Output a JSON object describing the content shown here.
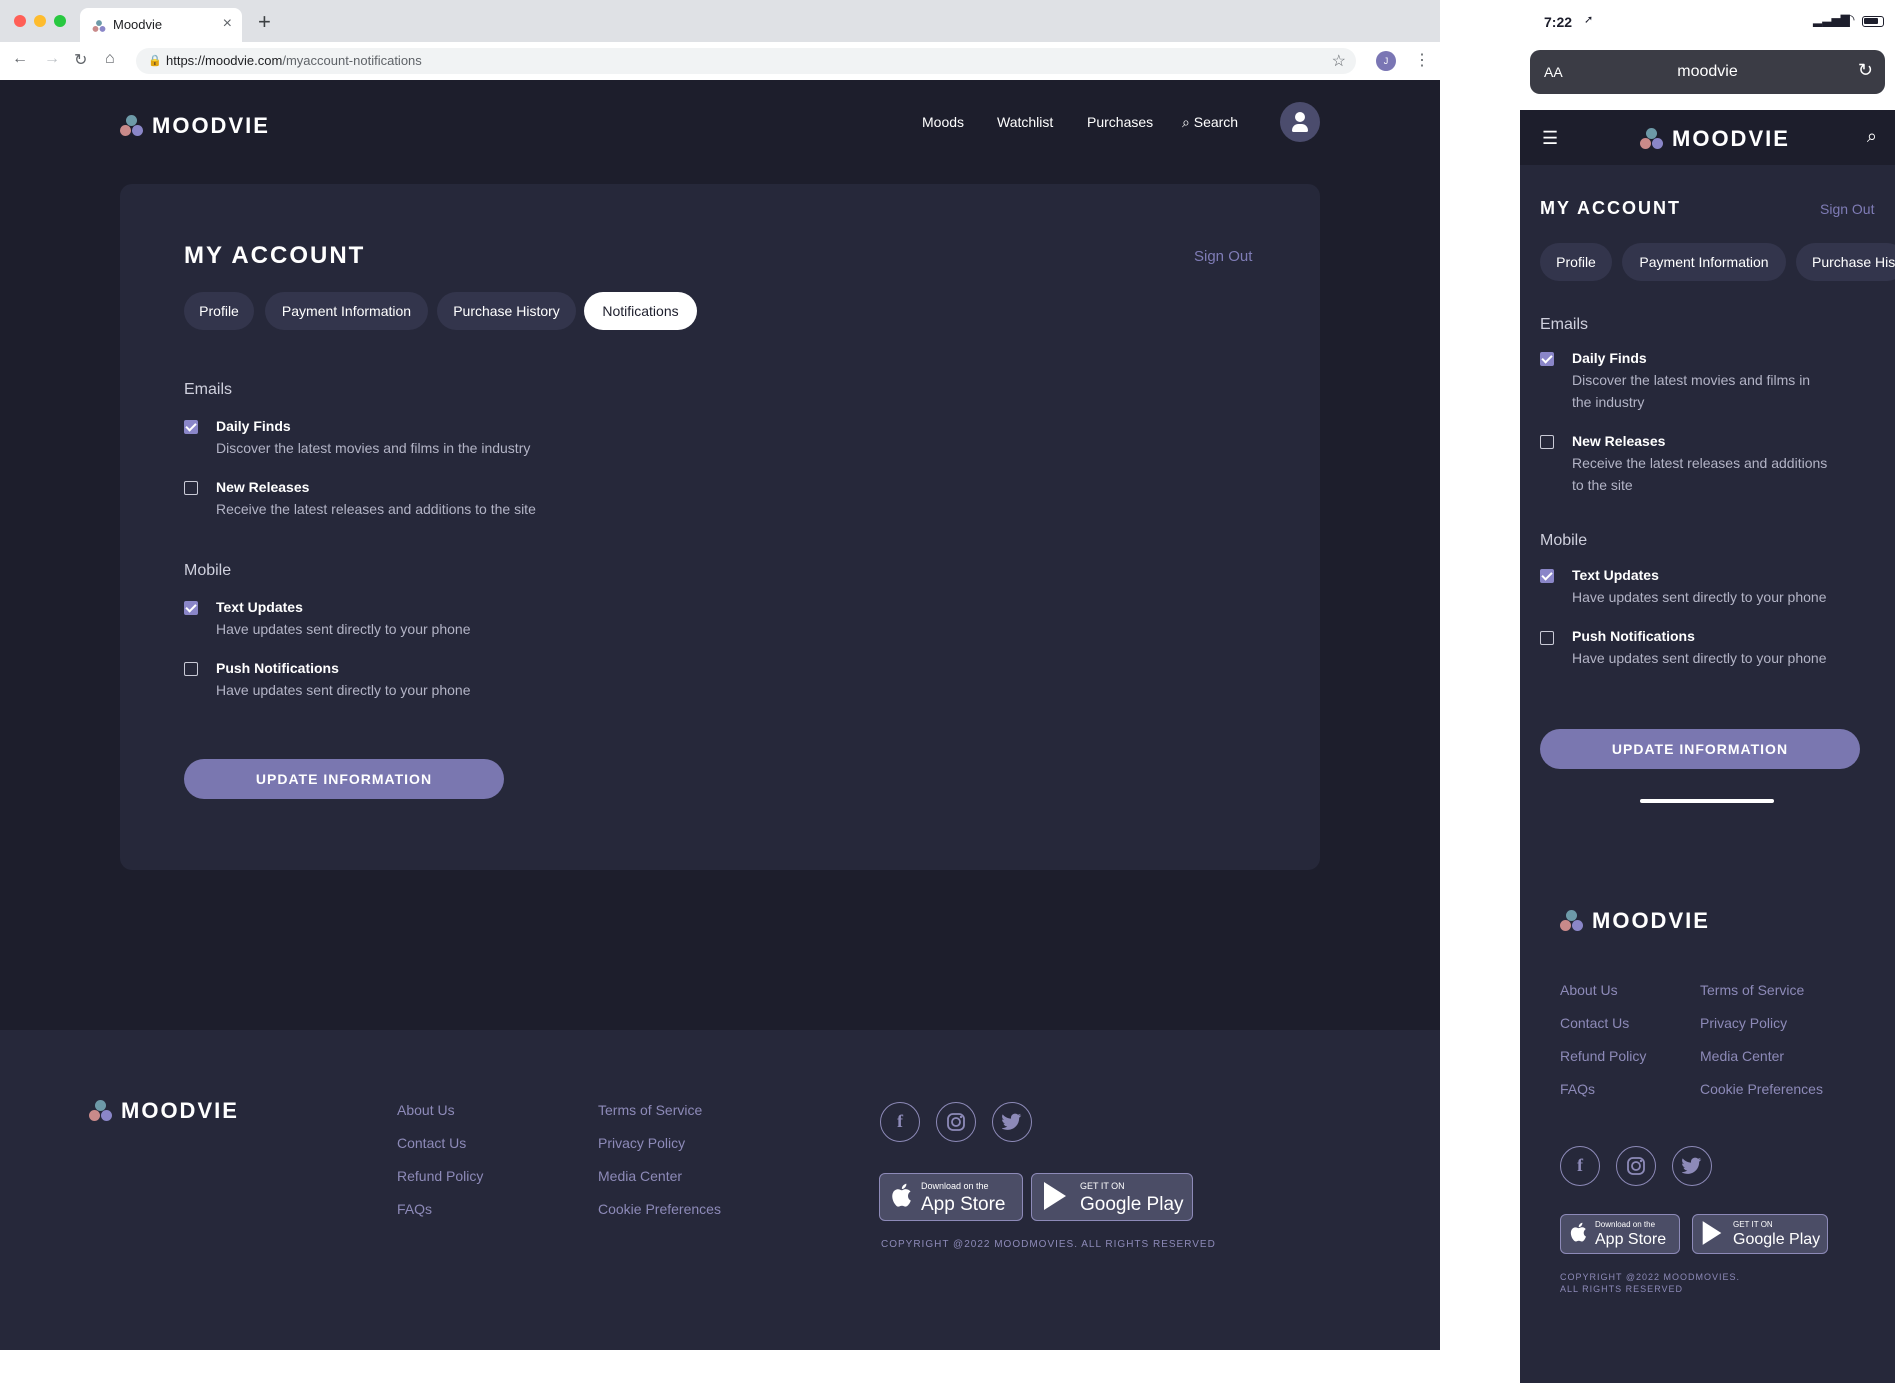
{
  "browser": {
    "tab_title": "Moodvie",
    "url_host": "https://moodvie.com",
    "url_path": "/myaccount-notifications",
    "profile_initial": "J"
  },
  "brand": {
    "name": "MOODVIE"
  },
  "nav": {
    "moods": "Moods",
    "watchlist": "Watchlist",
    "purchases": "Purchases",
    "search": "Search"
  },
  "account": {
    "title": "MY ACCOUNT",
    "sign_out": "Sign Out",
    "tabs": [
      "Profile",
      "Payment Information",
      "Purchase History",
      "Notifications"
    ],
    "tabs_mobile": [
      "Profile",
      "Payment Information",
      "Purchase Hist"
    ],
    "active_tab": "Notifications",
    "emails_heading": "Emails",
    "mobile_heading": "Mobile",
    "options": [
      {
        "label": "Daily Finds",
        "desc": "Discover the latest movies and films in the industry",
        "desc_m1": "Discover the latest movies and films in",
        "desc_m2": "the industry",
        "checked": true
      },
      {
        "label": "New Releases",
        "desc": "Receive the latest releases and additions to the site",
        "desc_m1": "Receive the latest releases and additions",
        "desc_m2": "to the site",
        "checked": false
      },
      {
        "label": "Text Updates",
        "desc": "Have updates sent directly to your phone",
        "checked": true
      },
      {
        "label": "Push Notifications",
        "desc": "Have updates sent directly to your phone",
        "checked": false
      }
    ],
    "update_button": "UPDATE INFORMATION"
  },
  "footer": {
    "links_col1": [
      "About Us",
      "Contact Us",
      "Refund Policy",
      "FAQs"
    ],
    "links_col2": [
      "Terms of Service",
      "Privacy Policy",
      "Media Center",
      "Cookie Preferences"
    ],
    "app_store": {
      "small": "Download on the",
      "big": "App Store"
    },
    "google_play": {
      "small": "GET IT ON",
      "big": "Google Play"
    },
    "copyright": "COPYRIGHT @2022 MOODMOVIES. ALL RIGHTS RESERVED",
    "copyright_m1": "COPYRIGHT @2022 MOODMOVIES.",
    "copyright_m2": "ALL RIGHTS RESERVED"
  },
  "mobile": {
    "time": "7:22",
    "text_size": "AA",
    "url": "moodvie"
  },
  "colors": {
    "accent": "#7a77b0",
    "bg": "#1d1e2c",
    "card": "#26283a"
  }
}
